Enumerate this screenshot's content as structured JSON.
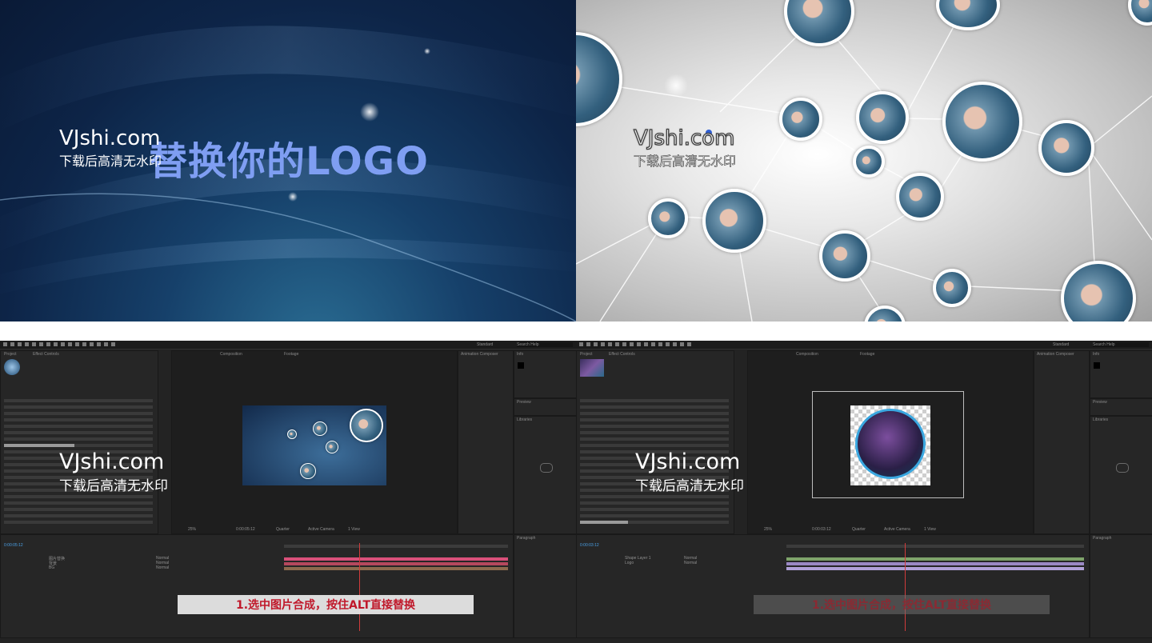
{
  "top_left": {
    "logo_text": "替换你的LOGO",
    "watermark": {
      "site": "VJshi.com",
      "subtitle": "下载后高清无水印"
    }
  },
  "top_right": {
    "watermark": {
      "site": "VJshi.com",
      "subtitle": "下载后高清无水印"
    }
  },
  "bottom_left": {
    "watermark": {
      "site": "VJshi.com",
      "subtitle": "下载后高清无水印"
    },
    "caption": "1.选中图片合成，按住ALT直接替换",
    "menu_items": [
      "Project",
      "Effect Controls",
      "Composition",
      "Footage"
    ],
    "workspace": "Standard",
    "search_placeholder": "Search Help",
    "timecode": "0:00:05:12",
    "zoom": "25%",
    "resolution": "Quarter",
    "camera": "Active Camera",
    "view": "1 View",
    "panels": {
      "preview": "Preview",
      "libraries": "Libraries",
      "paragraph": "Paragraph",
      "info": "Info",
      "animation": "Animation Composer"
    },
    "layer_names": [
      "图片替换",
      "背景",
      "BG"
    ],
    "modes": [
      "Normal",
      "Normal",
      "Normal"
    ],
    "timeline_colors": [
      "#d9507a",
      "#b5485e",
      "#8c6a4e"
    ]
  },
  "bottom_right": {
    "watermark": {
      "site": "VJshi.com",
      "subtitle": "下载后高清无水印"
    },
    "caption": "1.选中图片合成，按住ALT直接替换",
    "menu_items": [
      "Project",
      "Effect Controls",
      "Composition",
      "Footage"
    ],
    "workspace": "Standard",
    "search_placeholder": "Search Help",
    "timecode": "0:00:03:12",
    "zoom": "25%",
    "resolution": "Quarter",
    "camera": "Active Camera",
    "view": "1 View",
    "panels": {
      "preview": "Preview",
      "libraries": "Libraries",
      "paragraph": "Paragraph",
      "info": "Info",
      "animation": "Animation Composer"
    },
    "layer_names": [
      "Shape Layer 1",
      "Logo"
    ],
    "modes": [
      "Normal",
      "Normal"
    ],
    "timeline_colors": [
      "#7ea36a",
      "#9a88c4",
      "#b0a0d8"
    ]
  }
}
